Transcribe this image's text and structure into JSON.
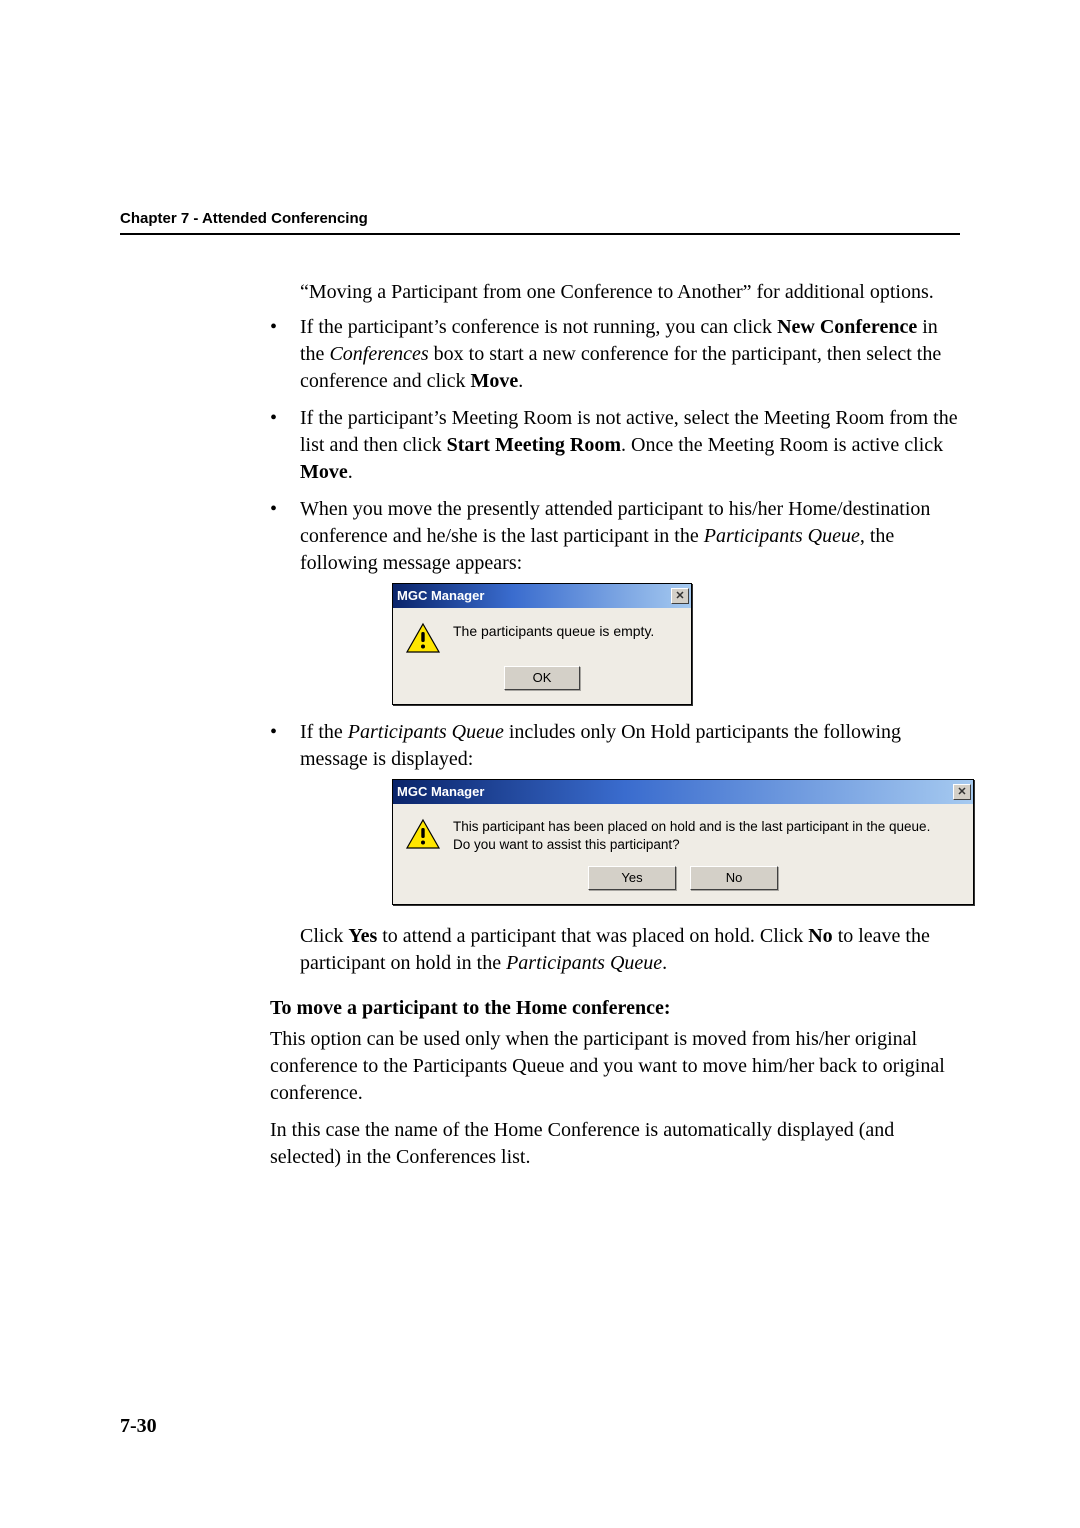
{
  "chapter_header": "Chapter 7 - Attended Conferencing",
  "intro_para": "“Moving a Participant from one Conference to Another” for additional options.",
  "bullet1": {
    "t1": "If the participant’s conference is not running, you can click ",
    "b1": "New Conference",
    "t2": " in the ",
    "i1": "Conferences",
    "t3": " box to start a new conference for the participant, then select the conference and click ",
    "b2": "Move",
    "t4": "."
  },
  "bullet2": {
    "t1": "If the participant’s Meeting Room is not active, select the Meeting Room from the list and then click ",
    "b1": "Start Meeting Room",
    "t2": ". Once the Meeting Room is active click ",
    "b2": "Move",
    "t3": "."
  },
  "bullet3": {
    "t1": "When you move the presently attended participant to his/her Home/destination conference and he/she is the last participant in the ",
    "i1": "Participants Queue",
    "t2": ", the following message appears:"
  },
  "dialog1": {
    "title": "MGC Manager",
    "message": "The participants queue is empty.",
    "ok": "OK"
  },
  "bullet4": {
    "t1": "If the ",
    "i1": "Participants Queue",
    "t2": " includes only On Hold participants the following message is displayed:"
  },
  "dialog2": {
    "title": "MGC Manager",
    "message_l1": "This participant has been placed on hold and is the last participant in the queue.",
    "message_l2": "Do you want to assist this participant?",
    "yes": "Yes",
    "no": "No"
  },
  "after_dialog2": {
    "t1": "Click ",
    "b1": "Yes",
    "t2": " to attend a participant that was placed on hold. Click ",
    "b2": "No",
    "t3": " to leave the participant on hold in the ",
    "i1": "Participants Queue",
    "t4": "."
  },
  "section_heading": "To move a participant to the Home conference:",
  "para1": "This option can be used only when the participant is moved from his/her original conference to the Participants Queue and you want to move him/her back to original conference.",
  "para2": "In this case the name of the Home Conference is automatically displayed (and selected) in the Conferences list.",
  "page_number": "7-30",
  "close_glyph": "✕"
}
